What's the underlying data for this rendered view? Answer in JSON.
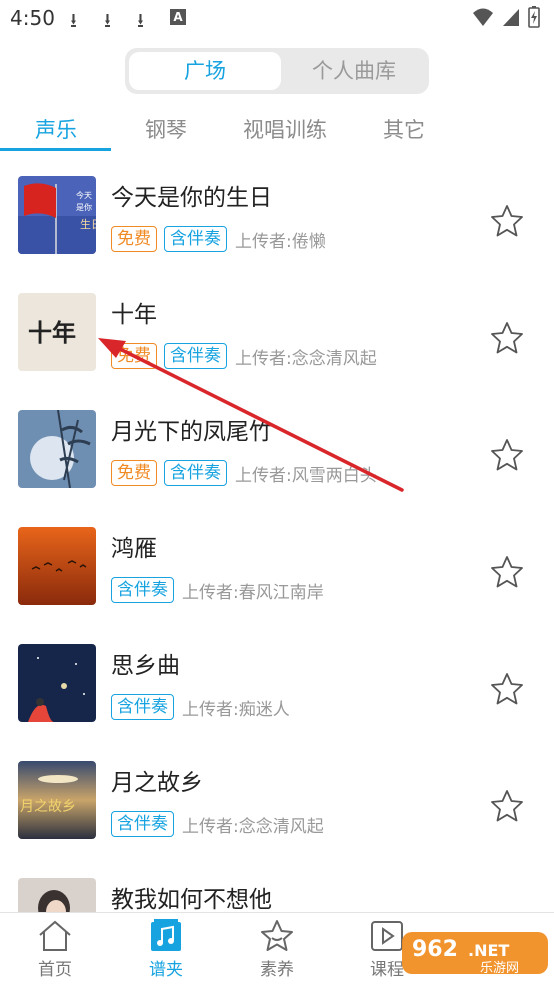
{
  "status_bar": {
    "time": "4:50",
    "extra_icon_letter": "A"
  },
  "segment": {
    "active": "广场",
    "inactive": "个人曲库"
  },
  "tabs": [
    {
      "label": "声乐",
      "active": true
    },
    {
      "label": "钢琴",
      "active": false
    },
    {
      "label": "视唱训练",
      "active": false
    },
    {
      "label": "其它",
      "active": false
    }
  ],
  "songs": [
    {
      "title": "今天是你的生日",
      "free": "免费",
      "accompaniment": "含伴奏",
      "uploader": "上传者:倦懒"
    },
    {
      "title": "十年",
      "free": "免费",
      "accompaniment": "含伴奏",
      "uploader": "上传者:念念清风起"
    },
    {
      "title": "月光下的凤尾竹",
      "free": "免费",
      "accompaniment": "含伴奏",
      "uploader": "上传者:风雪两白头"
    },
    {
      "title": "鸿雁",
      "accompaniment": "含伴奏",
      "uploader": "上传者:春风江南岸"
    },
    {
      "title": "思乡曲",
      "accompaniment": "含伴奏",
      "uploader": "上传者:痴迷人"
    },
    {
      "title": "月之故乡",
      "accompaniment": "含伴奏",
      "uploader": "上传者:念念清风起"
    },
    {
      "title": "教我如何不想他"
    }
  ],
  "cover_art_text": {
    "birthday": "今天是你的生日",
    "shinian": "十年",
    "moon_home": "月之故乡"
  },
  "bottom_nav": [
    {
      "label": "首页",
      "icon": "home-icon",
      "active": false
    },
    {
      "label": "谱夹",
      "icon": "music-folder-icon",
      "active": true
    },
    {
      "label": "素养",
      "icon": "star-badge-icon",
      "active": false
    },
    {
      "label": "课程",
      "icon": "video-icon",
      "active": false
    }
  ],
  "watermark": {
    "brand_num": "962",
    "brand_tld": ".NET",
    "brand_cn": "乐游网"
  },
  "colors": {
    "accent": "#16a3e0",
    "free_tag": "#f08a24",
    "annotation_arrow": "#d9262b"
  }
}
